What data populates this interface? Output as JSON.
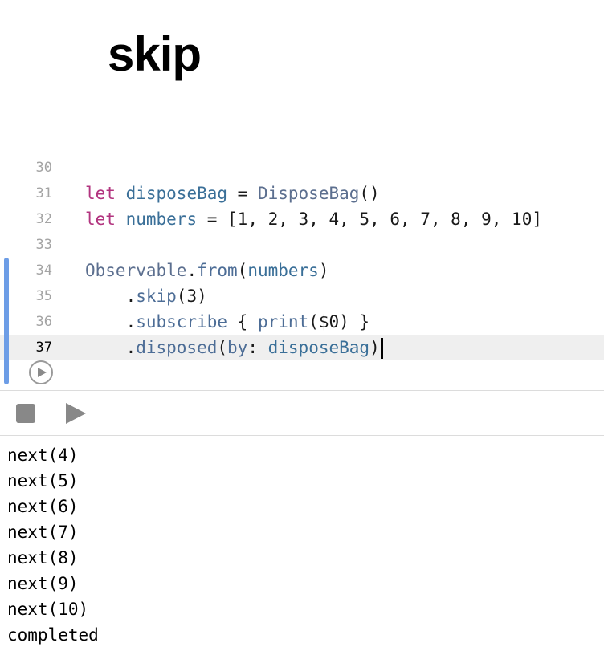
{
  "page": {
    "title": "skip"
  },
  "editor": {
    "lines": [
      {
        "number": "30",
        "tokens": []
      },
      {
        "number": "31",
        "tokens": [
          {
            "cls": "kw",
            "text": "let"
          },
          {
            "cls": "nm",
            "text": " "
          },
          {
            "cls": "id",
            "text": "disposeBag"
          },
          {
            "cls": "nm",
            "text": " = "
          },
          {
            "cls": "ty",
            "text": "DisposeBag"
          },
          {
            "cls": "nm",
            "text": "()"
          }
        ]
      },
      {
        "number": "32",
        "tokens": [
          {
            "cls": "kw",
            "text": "let"
          },
          {
            "cls": "nm",
            "text": " "
          },
          {
            "cls": "id",
            "text": "numbers"
          },
          {
            "cls": "nm",
            "text": " = [1, 2, 3, 4, 5, 6, 7, 8, 9, 10]"
          }
        ]
      },
      {
        "number": "33",
        "tokens": []
      },
      {
        "number": "34",
        "tokens": [
          {
            "cls": "ty",
            "text": "Observable"
          },
          {
            "cls": "nm",
            "text": "."
          },
          {
            "cls": "fn",
            "text": "from"
          },
          {
            "cls": "nm",
            "text": "("
          },
          {
            "cls": "id",
            "text": "numbers"
          },
          {
            "cls": "nm",
            "text": ")"
          }
        ]
      },
      {
        "number": "35",
        "tokens": [
          {
            "cls": "nm",
            "text": "    ."
          },
          {
            "cls": "fn",
            "text": "skip"
          },
          {
            "cls": "nm",
            "text": "(3)"
          }
        ]
      },
      {
        "number": "36",
        "tokens": [
          {
            "cls": "nm",
            "text": "    ."
          },
          {
            "cls": "fn",
            "text": "subscribe"
          },
          {
            "cls": "nm",
            "text": " { "
          },
          {
            "cls": "fn",
            "text": "print"
          },
          {
            "cls": "nm",
            "text": "($0) }"
          }
        ]
      },
      {
        "number": "37",
        "current": true,
        "cursor": true,
        "tokens": [
          {
            "cls": "nm",
            "text": "    ."
          },
          {
            "cls": "fn",
            "text": "disposed"
          },
          {
            "cls": "nm",
            "text": "("
          },
          {
            "cls": "fn",
            "text": "by"
          },
          {
            "cls": "nm",
            "text": ": "
          },
          {
            "cls": "id",
            "text": "disposeBag"
          },
          {
            "cls": "nm",
            "text": ")"
          }
        ]
      }
    ],
    "icons": {
      "run_line": "play-circle-icon"
    }
  },
  "toolbar": {
    "stop_icon": "stop-icon",
    "play_icon": "play-icon"
  },
  "console": {
    "lines": [
      "next(4)",
      "next(5)",
      "next(6)",
      "next(7)",
      "next(8)",
      "next(9)",
      "next(10)",
      "completed"
    ]
  },
  "colors": {
    "keyword": "#b2347f",
    "identifier": "#3a6f98",
    "type": "#5c6f8f",
    "function": "#4d6d96",
    "line_number": "#a4a4a4",
    "current_line_bg": "#efefef",
    "change_bar": "#6d9de6"
  }
}
